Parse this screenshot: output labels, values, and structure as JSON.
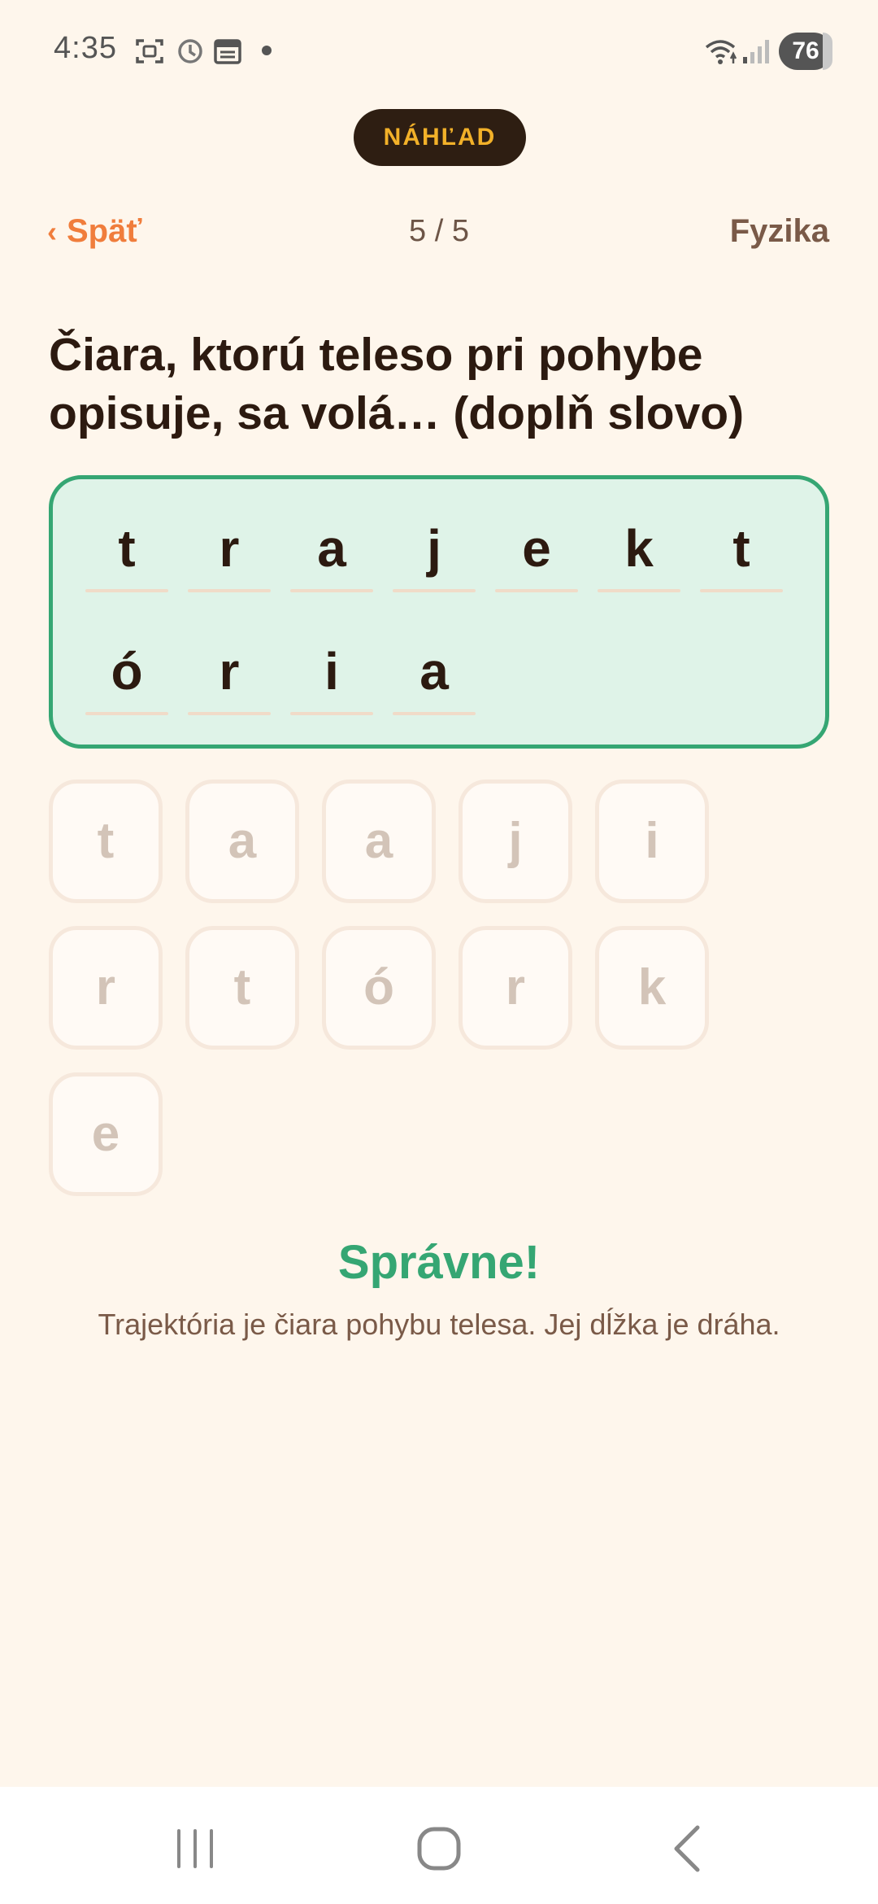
{
  "status_bar": {
    "time": "4:35",
    "battery": "76",
    "icons": [
      "screenshot-icon",
      "alarm-icon",
      "calendar-icon",
      "notification-dot-icon",
      "wifi-icon",
      "signal-icon",
      "battery-icon"
    ]
  },
  "preview_badge": "NÁHĽAD",
  "header": {
    "back_chevron": "‹",
    "back_label": "Späť",
    "progress": "5 / 5",
    "subject": "Fyzika"
  },
  "question": "Čiara, ktorú teleso pri pohybe opisuje, sa volá… (doplň slovo)",
  "answer": {
    "row1": [
      "t",
      "r",
      "a",
      "j",
      "e",
      "k",
      "t"
    ],
    "row2": [
      "ó",
      "r",
      "i",
      "a"
    ]
  },
  "tiles": {
    "row1": [
      "t",
      "a",
      "a",
      "j",
      "i"
    ],
    "row2": [
      "r",
      "t",
      "ó",
      "r",
      "k"
    ],
    "row3": [
      "e"
    ]
  },
  "feedback": {
    "title": "Správne!",
    "explanation": "Trajektória je čiara pohybu telesa. Jej dĺžka je dráha."
  },
  "colors": {
    "background": "#fef6ec",
    "accent_orange": "#f07d3c",
    "success_green": "#35a673",
    "answer_bg": "#dff3e8",
    "pill_bg": "#2e1e12",
    "pill_text": "#f2b129"
  },
  "nav_bar": [
    "recent-apps-icon",
    "home-icon",
    "back-icon"
  ]
}
